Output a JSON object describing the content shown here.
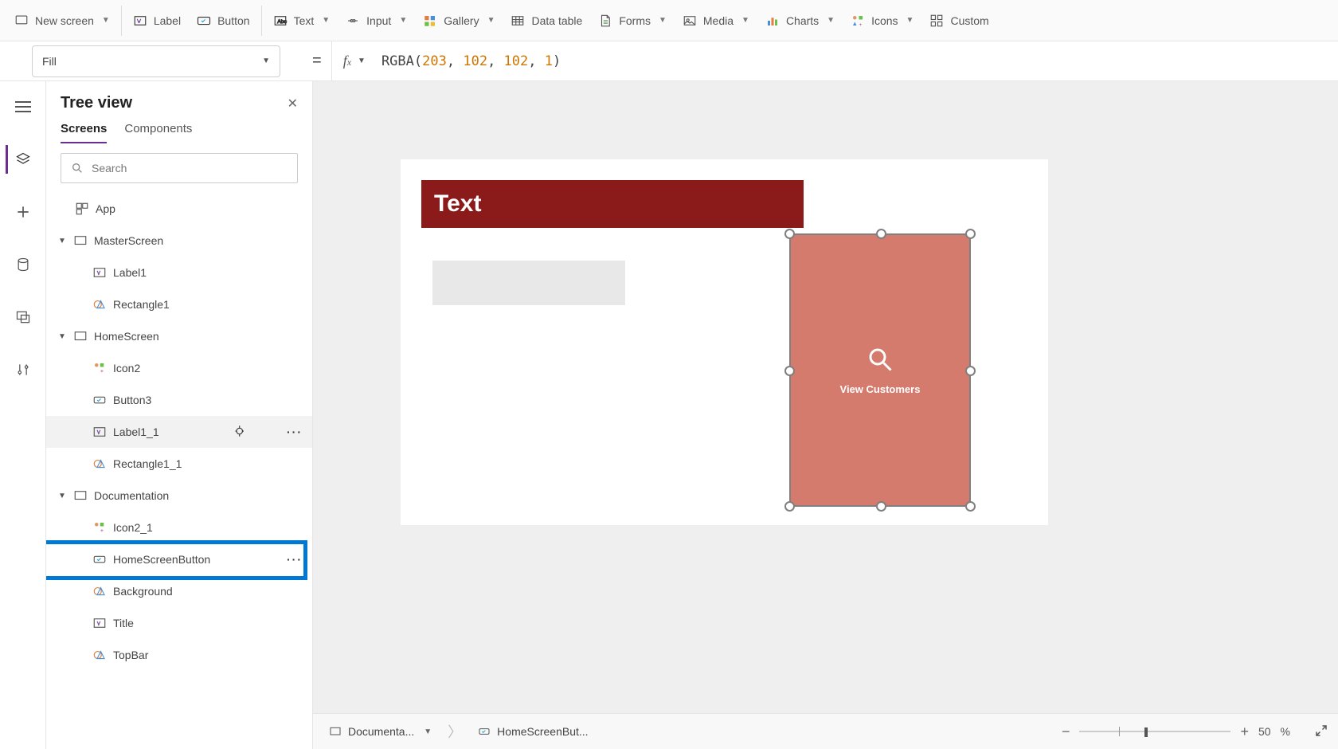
{
  "ribbon": {
    "new_screen": "New screen",
    "label": "Label",
    "button": "Button",
    "text": "Text",
    "input": "Input",
    "gallery": "Gallery",
    "data_table": "Data table",
    "forms": "Forms",
    "media": "Media",
    "charts": "Charts",
    "icons": "Icons",
    "custom": "Custom"
  },
  "formula": {
    "property": "Fill",
    "fn": "RGBA",
    "a1": "203",
    "a2": "102",
    "a3": "102",
    "a4": "1"
  },
  "tree": {
    "title": "Tree view",
    "tabs": {
      "screens": "Screens",
      "components": "Components"
    },
    "search_placeholder": "Search",
    "items": {
      "app": "App",
      "master": "MasterScreen",
      "label1": "Label1",
      "rect1": "Rectangle1",
      "home": "HomeScreen",
      "icon2": "Icon2",
      "button3": "Button3",
      "label1_1": "Label1_1",
      "rect1_1": "Rectangle1_1",
      "doc": "Documentation",
      "icon2_1": "Icon2_1",
      "hsb": "HomeScreenButton",
      "background": "Background",
      "title": "Title",
      "topbar": "TopBar"
    }
  },
  "canvas": {
    "header_text": "Text",
    "button_label": "View Customers"
  },
  "bottom": {
    "crumb1": "Documenta...",
    "crumb2": "HomeScreenBut...",
    "zoom_label": "50",
    "zoom_pct": "%"
  }
}
